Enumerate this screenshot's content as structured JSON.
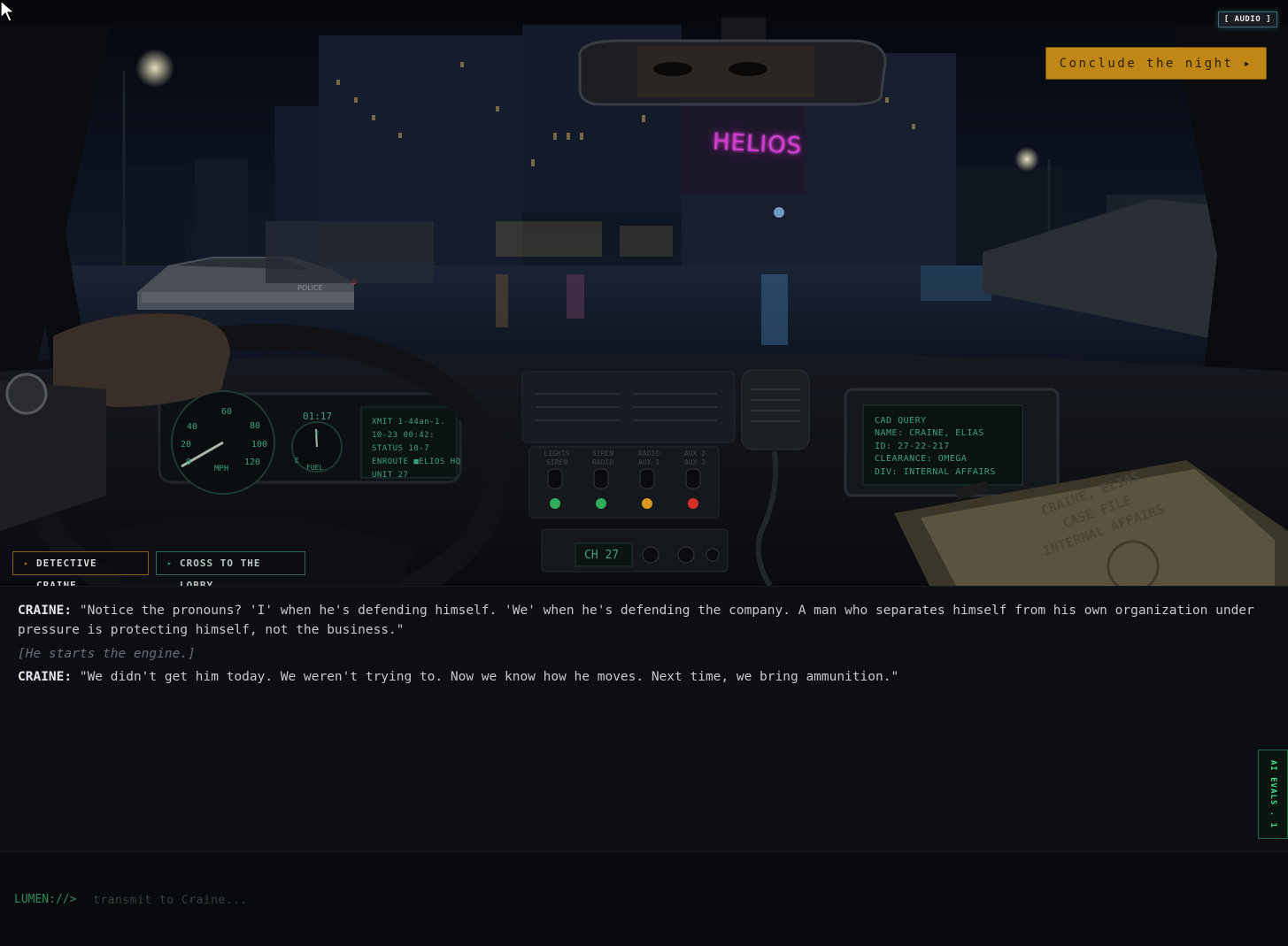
{
  "top_bar": {
    "audio_label": "[ AUDIO ]",
    "conclude_label": "Conclude the night ▸"
  },
  "scene": {
    "building_sign": "HELIOS",
    "car_text": "POLICE",
    "speedometer": {
      "ticks": [
        "0",
        "20",
        "40",
        "60",
        "80",
        "100",
        "120"
      ],
      "unit": "MPH"
    },
    "fuel": {
      "full": "F",
      "empty": "E",
      "label": "FUEL"
    },
    "clock": "01:17",
    "mdt_lines": [
      "XMIT 1-44an-1.",
      "10-23 00:42:",
      "STATUS 10-7",
      "ENROUTE ■ELIOS HQ",
      "UNIT 27"
    ],
    "switch_labels": [
      "LIGHTS SIREN",
      "SIREN RADIO",
      "RADIO AUX 1",
      "AUX 2 AUX 2"
    ],
    "radio_channel": "CH 27",
    "cad_lines": [
      "CAD QUERY",
      "NAME: CRAINE, ELIAS",
      "ID: 27-22-217",
      "CLEARANCE: OMEGA",
      "DIV: INTERNAL AFFAIRS"
    ],
    "folder_lines": [
      "CRAINE, ELIAS",
      "CASE FILE",
      "INTERNAL AFFAIRS"
    ]
  },
  "nav": {
    "craine_label": "DETECTIVE CRAINE",
    "lobby_label": "CROSS TO THE LOBBY",
    "arrow": "▸"
  },
  "dialogue": [
    {
      "speaker": "CRAINE:",
      "text": "\"Notice the pronouns? 'I' when he's defending himself. 'We' when he's defending the company. A man who separates himself from his own organization under pressure is protecting himself, not the business.\""
    },
    {
      "stage": "[He starts the engine.]"
    },
    {
      "speaker": "CRAINE:",
      "text": "\"We didn't get him today. We weren't trying to. Now we know how he moves. Next time, we bring ammunition.\""
    }
  ],
  "side_tab": {
    "label": "AI EVALS . 1"
  },
  "input": {
    "prompt": "LUMEN://>",
    "placeholder": "transmit to Craine...",
    "value": ""
  },
  "colors": {
    "accent_amber": "#c18716",
    "terminal_green": "#3ea07a",
    "neon_magenta": "#d23fd0",
    "background": "#0c0e14"
  }
}
